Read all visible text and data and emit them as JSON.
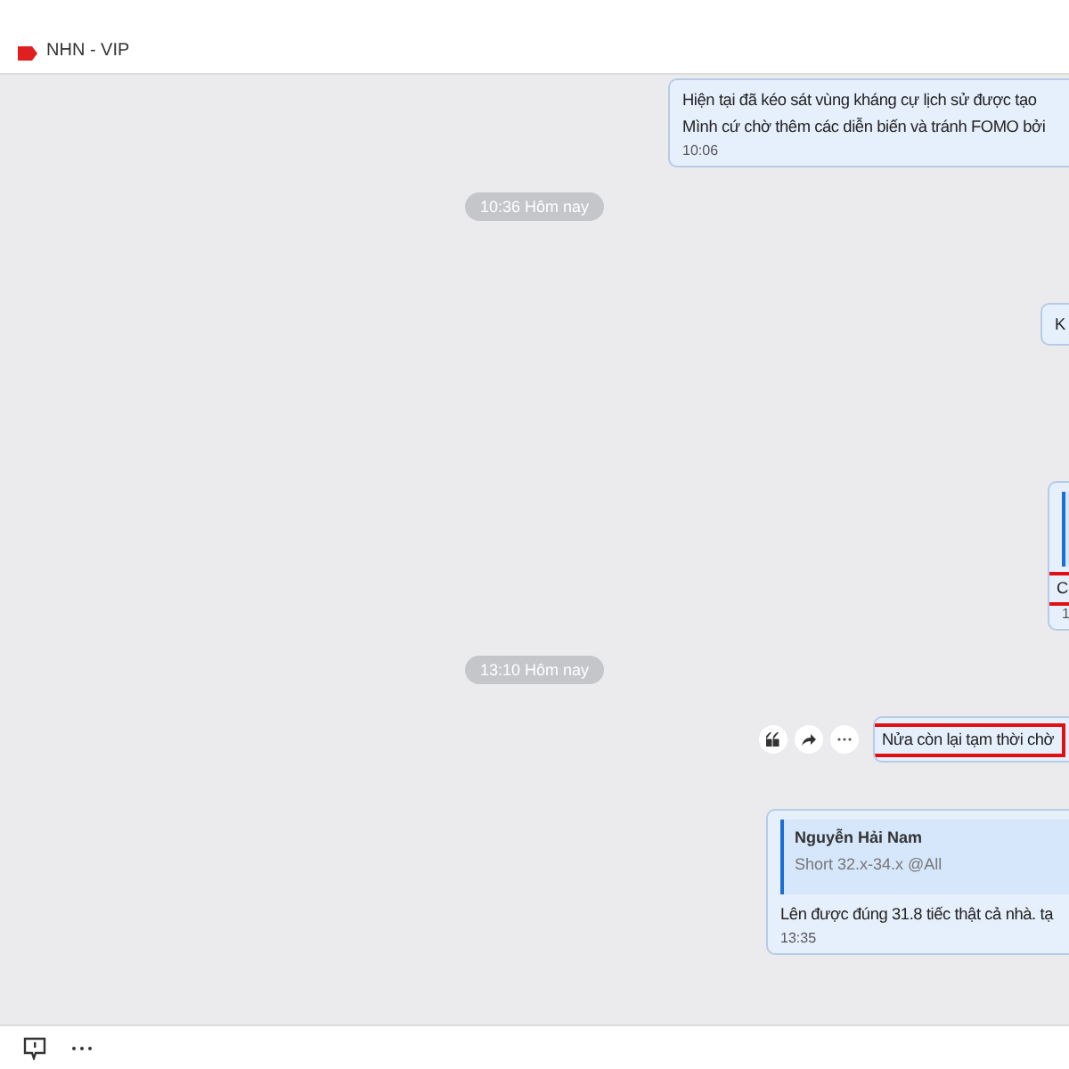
{
  "header": {
    "tag": "NHN - VIP"
  },
  "messages": [
    {
      "kind": "message",
      "lines": [
        "Hiện tại đã kéo sát vùng kháng cự lịch sử được tạo",
        "Mình cứ chờ thêm các diễn biến và tránh FOMO bởi"
      ],
      "time": "10:06",
      "highlighted": false
    },
    {
      "kind": "date",
      "label": "10:36 Hôm nay"
    },
    {
      "kind": "message",
      "lines": [
        "K"
      ],
      "highlighted": false
    },
    {
      "kind": "message",
      "quote": {
        "bar": true
      },
      "lines": [
        "C"
      ],
      "time": "1",
      "highlighted": true
    },
    {
      "kind": "date",
      "label": "13:10 Hôm nay"
    },
    {
      "kind": "message",
      "actions": true,
      "lines": [
        "Nửa còn lại tạm thời chờ"
      ],
      "highlighted": true
    },
    {
      "kind": "message",
      "quote": {
        "author": "Nguyễn Hải Nam",
        "text": "Short 32.x-34.x @All"
      },
      "lines": [
        "Lên được đúng 31.8 tiếc thật cả nhà. tạ"
      ],
      "time": "13:35",
      "highlighted": false
    }
  ]
}
